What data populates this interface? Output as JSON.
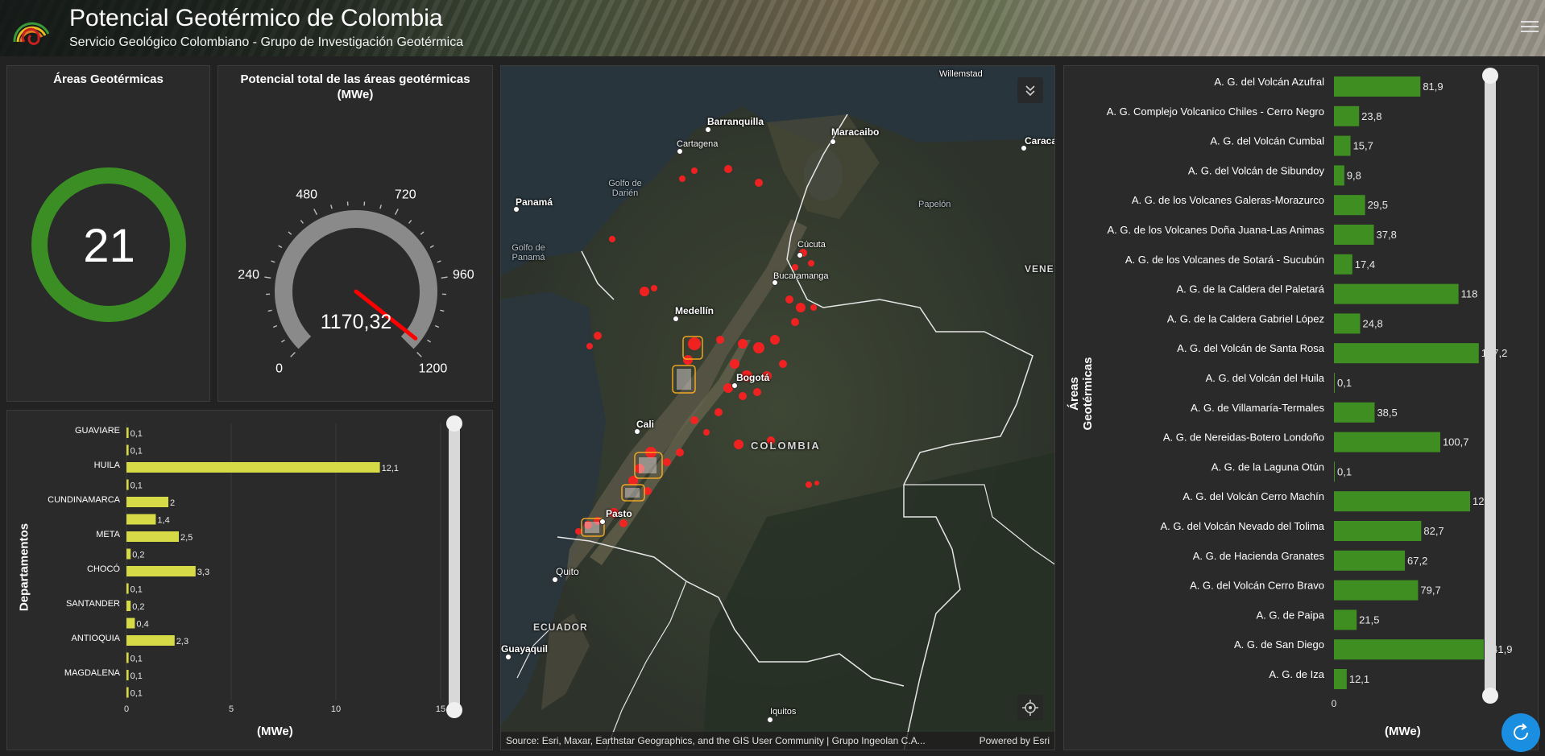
{
  "header": {
    "title": "Potencial Geotérmico de Colombia",
    "subtitle": "Servicio Geológico Colombiano - Grupo de Investigación Geotérmica"
  },
  "indicator": {
    "title": "Áreas Geotérmicas",
    "value": "21",
    "ring_color": "#3a8e24"
  },
  "gauge": {
    "title_line1": "Potencial total de las áreas geotérmicas",
    "title_line2": "(MWe)",
    "value": 1170.32,
    "value_label": "1170,32",
    "min": 0,
    "max": 1200,
    "tick_labels": [
      "0",
      "240",
      "480",
      "720",
      "960",
      "1200"
    ],
    "needle_color": "#ff0000"
  },
  "dept_chart": {
    "ylabel": "Departamentos",
    "xlabel": "(MWe)",
    "xticks": [
      "0",
      "5",
      "10",
      "15"
    ]
  },
  "areas_chart": {
    "ylabel": "Áreas Geotérmicas",
    "xlabel": "(MWe)",
    "xtick0": "0"
  },
  "map": {
    "labels": [
      {
        "name": "lbl-barranquilla",
        "text": "Barranquilla"
      },
      {
        "name": "lbl-cartagena",
        "text": "Cartagena"
      },
      {
        "name": "lbl-maracaibo",
        "text": "Maracaibo"
      },
      {
        "name": "lbl-willemstad",
        "text": "Willemstad"
      },
      {
        "name": "lbl-caracas",
        "text": "Caraca"
      },
      {
        "name": "lbl-panama",
        "text": "Panamá"
      },
      {
        "name": "lbl-golfo-darien",
        "text": "Golfo de Darién"
      },
      {
        "name": "lbl-golfo-panama",
        "text": "Golfo de Panamá"
      },
      {
        "name": "lbl-papelon",
        "text": "Papelón"
      },
      {
        "name": "lbl-cucuta",
        "text": "Cúcuta"
      },
      {
        "name": "lbl-bucaramanga",
        "text": "Bucaramanga"
      },
      {
        "name": "lbl-vene",
        "text": "VENE"
      },
      {
        "name": "lbl-medellin",
        "text": "Medellín"
      },
      {
        "name": "lbl-bogota",
        "text": "Bogotá"
      },
      {
        "name": "lbl-cali",
        "text": "Cali"
      },
      {
        "name": "lbl-colombia",
        "text": "COLOMBIA"
      },
      {
        "name": "lbl-pasto",
        "text": "Pasto"
      },
      {
        "name": "lbl-quito",
        "text": "Quito"
      },
      {
        "name": "lbl-ecuador",
        "text": "ECUADOR"
      },
      {
        "name": "lbl-guayaquil",
        "text": "Guayaquil"
      },
      {
        "name": "lbl-iquitos",
        "text": "Iquitos"
      }
    ],
    "attribution": "Source: Esri, Maxar, Earthstar Geographics, and the GIS User Community | Grupo Ingeolan C.A...",
    "powered_by": "Powered by Esri"
  },
  "chart_data": [
    {
      "type": "bar",
      "orientation": "horizontal",
      "xlabel": "(MWe)",
      "ylabel": "Departamentos",
      "xlim": [
        0,
        15
      ],
      "bar_color": "#d6da46",
      "categories": [
        "GUAVIARE",
        "",
        "HUILA",
        "",
        "CUNDINAMARCA",
        "",
        "META",
        "",
        "CHOCÓ",
        "",
        "SANTANDER",
        "",
        "ANTIOQUIA",
        "",
        "MAGDALENA",
        ""
      ],
      "values": [
        0.1,
        0.1,
        12.1,
        0.1,
        2,
        1.4,
        2.5,
        0.2,
        3.3,
        0.1,
        0.2,
        0.4,
        2.3,
        0.1,
        0.1,
        0.1
      ],
      "value_labels": [
        "0,1",
        "0,1",
        "12,1",
        "0,1",
        "2",
        "1,4",
        "2,5",
        "0,2",
        "3,3",
        "0,1",
        "0,2",
        "0,4",
        "2,3",
        "0,1",
        "0,1",
        "0,1"
      ]
    },
    {
      "type": "bar",
      "orientation": "horizontal",
      "xlabel": "(MWe)",
      "ylabel": "Áreas Geotérmicas",
      "bar_color": "#3f8e22",
      "categories": [
        "A. G. del Volcán Azufral",
        "A. G. Complejo Volcanico Chiles - Cerro Negro",
        "A. G. del Volcán Cumbal",
        "A. G. del Volcán de Sibundoy",
        "A. G. de los Volcanes Galeras-Morazurco",
        "A. G. de los Volcanes Doña Juana-Las Animas",
        "A. G. de los Volcanes de Sotará - Sucubún",
        "A. G. de la Caldera del Paletará",
        "A. G. de la Caldera Gabriel López",
        "A. G. del Volcán de Santa Rosa",
        "A. G. del Volcán del Huila",
        "A. G. de Villamaría-Termales",
        "A. G. de Nereidas-Botero Londoño",
        "A. G. de la Laguna Otún",
        "A. G. del Volcán Cerro Machín",
        "A. G. del Volcán Nevado del Tolima",
        "A. G. de Hacienda Granates",
        "A. G. del Volcán Cerro Bravo",
        "A. G. de Paipa",
        "A. G. de San Diego",
        "A. G. de Iza"
      ],
      "values": [
        81.9,
        23.8,
        15.7,
        9.8,
        29.5,
        37.8,
        17.4,
        118,
        24.8,
        137.2,
        0.1,
        38.5,
        100.7,
        0.1,
        129,
        82.7,
        67.2,
        79.7,
        21.5,
        141.9,
        12.1
      ],
      "value_labels": [
        "81,9",
        "23,8",
        "15,7",
        "9,8",
        "29,5",
        "37,8",
        "17,4",
        "118",
        "24,8",
        "137,2",
        "0,1",
        "38,5",
        "100,7",
        "0,1",
        "129",
        "82,7",
        "67,2",
        "79,7",
        "21,5",
        "141,9",
        "12,1"
      ]
    }
  ]
}
